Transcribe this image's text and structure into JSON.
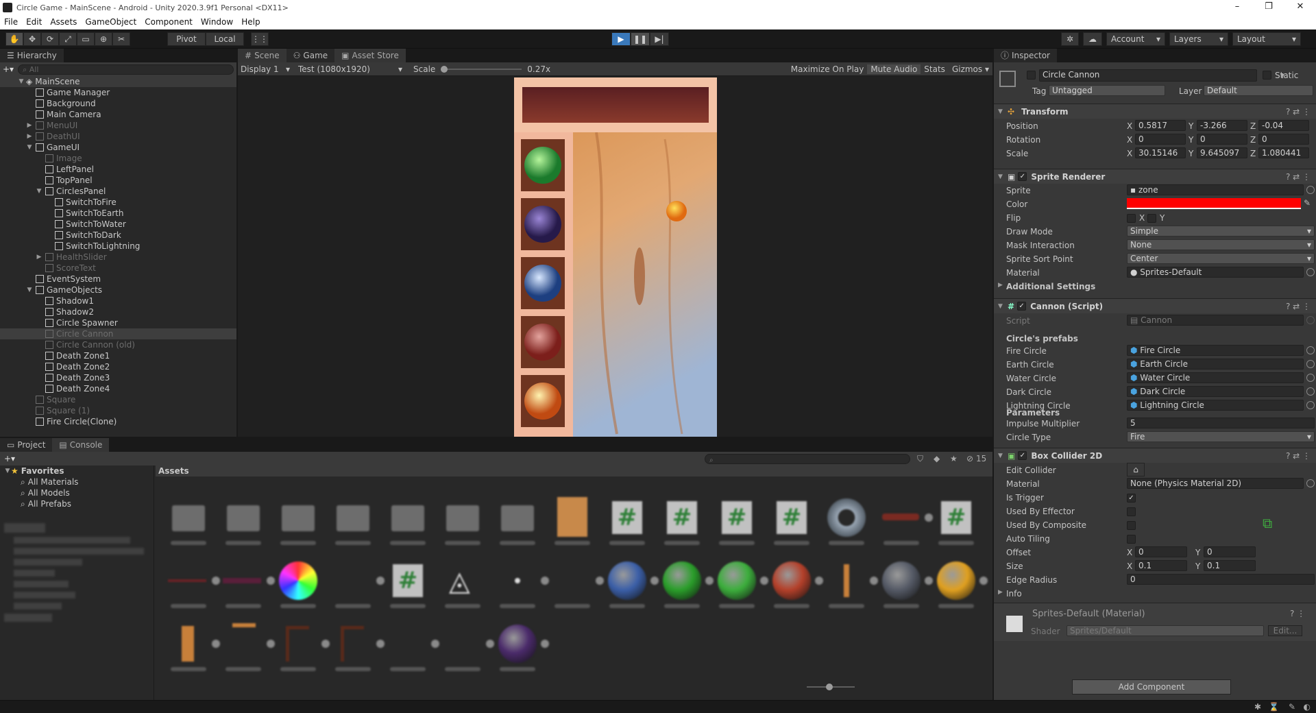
{
  "window": {
    "title": "Circle Game - MainScene - Android - Unity 2020.3.9f1 Personal <DX11>",
    "controls": [
      "–",
      "❐",
      "✕"
    ]
  },
  "menu": [
    "File",
    "Edit",
    "Assets",
    "GameObject",
    "Component",
    "Window",
    "Help"
  ],
  "toolbar": {
    "pivot": "Pivot",
    "local": "Local",
    "account": "Account",
    "layers": "Layers",
    "layout": "Layout"
  },
  "hierarchy": {
    "tab": "Hierarchy",
    "search_placeholder": "All",
    "scene": "MainScene",
    "items": [
      {
        "label": "Game Manager",
        "depth": 1,
        "dim": false,
        "fold": ""
      },
      {
        "label": "Background",
        "depth": 1,
        "dim": false,
        "fold": ""
      },
      {
        "label": "Main Camera",
        "depth": 1,
        "dim": false,
        "fold": ""
      },
      {
        "label": "MenuUI",
        "depth": 1,
        "dim": true,
        "fold": "▶"
      },
      {
        "label": "DeathUI",
        "depth": 1,
        "dim": true,
        "fold": "▶"
      },
      {
        "label": "GameUI",
        "depth": 1,
        "dim": false,
        "fold": "▼"
      },
      {
        "label": "Image",
        "depth": 2,
        "dim": true,
        "fold": ""
      },
      {
        "label": "LeftPanel",
        "depth": 2,
        "dim": false,
        "fold": ""
      },
      {
        "label": "TopPanel",
        "depth": 2,
        "dim": false,
        "fold": ""
      },
      {
        "label": "CirclesPanel",
        "depth": 2,
        "dim": false,
        "fold": "▼"
      },
      {
        "label": "SwitchToFire",
        "depth": 3,
        "dim": false,
        "fold": ""
      },
      {
        "label": "SwitchToEarth",
        "depth": 3,
        "dim": false,
        "fold": ""
      },
      {
        "label": "SwitchToWater",
        "depth": 3,
        "dim": false,
        "fold": ""
      },
      {
        "label": "SwitchToDark",
        "depth": 3,
        "dim": false,
        "fold": ""
      },
      {
        "label": "SwitchToLightning",
        "depth": 3,
        "dim": false,
        "fold": ""
      },
      {
        "label": "HealthSlider",
        "depth": 2,
        "dim": true,
        "fold": "▶"
      },
      {
        "label": "ScoreText",
        "depth": 2,
        "dim": true,
        "fold": ""
      },
      {
        "label": "EventSystem",
        "depth": 1,
        "dim": false,
        "fold": ""
      },
      {
        "label": "GameObjects",
        "depth": 1,
        "dim": false,
        "fold": "▼"
      },
      {
        "label": "Shadow1",
        "depth": 2,
        "dim": false,
        "fold": ""
      },
      {
        "label": "Shadow2",
        "depth": 2,
        "dim": false,
        "fold": ""
      },
      {
        "label": "Circle Spawner",
        "depth": 2,
        "dim": false,
        "fold": ""
      },
      {
        "label": "Circle Cannon",
        "depth": 2,
        "dim": true,
        "fold": "",
        "selected": true
      },
      {
        "label": "Circle Cannon (old)",
        "depth": 2,
        "dim": true,
        "fold": ""
      },
      {
        "label": "Death Zone1",
        "depth": 2,
        "dim": false,
        "fold": ""
      },
      {
        "label": "Death Zone2",
        "depth": 2,
        "dim": false,
        "fold": ""
      },
      {
        "label": "Death Zone3",
        "depth": 2,
        "dim": false,
        "fold": ""
      },
      {
        "label": "Death Zone4",
        "depth": 2,
        "dim": false,
        "fold": ""
      },
      {
        "label": "Square",
        "depth": 1,
        "dim": true,
        "fold": ""
      },
      {
        "label": "Square (1)",
        "depth": 1,
        "dim": true,
        "fold": ""
      },
      {
        "label": "Fire Circle(Clone)",
        "depth": 1,
        "dim": false,
        "fold": ""
      }
    ]
  },
  "gameview": {
    "tabs": [
      "Scene",
      "Game",
      "Asset Store"
    ],
    "display": "Display 1",
    "resolution": "Test (1080x1920)",
    "scale_label": "Scale",
    "scale_value": "0.27x",
    "maximize": "Maximize On Play",
    "mute": "Mute Audio",
    "stats": "Stats",
    "gizmos": "Gizmos"
  },
  "inspector": {
    "tab": "Inspector",
    "object_name": "Circle Cannon",
    "static_label": "Static",
    "tag_label": "Tag",
    "tag_value": "Untagged",
    "layer_label": "Layer",
    "layer_value": "Default",
    "transform": {
      "title": "Transform",
      "position_label": "Position",
      "position": [
        "0.5817",
        "-3.266",
        "-0.04"
      ],
      "rotation_label": "Rotation",
      "rotation": [
        "0",
        "0",
        "0"
      ],
      "scale_label": "Scale",
      "scale": [
        "30.15146",
        "9.645097",
        "1.080441"
      ]
    },
    "sprite_renderer": {
      "title": "Sprite Renderer",
      "sprite_label": "Sprite",
      "sprite": "zone",
      "color_label": "Color",
      "color": "#ff0000",
      "flip_label": "Flip",
      "flip_x": "X",
      "flip_y": "Y",
      "draw_mode_label": "Draw Mode",
      "draw_mode": "Simple",
      "mask_label": "Mask Interaction",
      "mask": "None",
      "sort_label": "Sprite Sort Point",
      "sort": "Center",
      "material_label": "Material",
      "material": "Sprites-Default",
      "additional": "Additional Settings"
    },
    "cannon": {
      "title": "Cannon (Script)",
      "script_label": "Script",
      "script": "Cannon",
      "prefabs_header": "Circle's prefabs",
      "prefabs": [
        {
          "label": "Fire Circle",
          "value": "Fire Circle"
        },
        {
          "label": "Earth Circle",
          "value": "Earth Circle"
        },
        {
          "label": "Water Circle",
          "value": "Water Circle"
        },
        {
          "label": "Dark Circle",
          "value": "Dark Circle"
        },
        {
          "label": "Lightning Circle",
          "value": "Lightning Circle"
        }
      ],
      "params_header": "Parameters",
      "impulse_label": "Impulse Multiplier",
      "impulse": "5",
      "circle_type_label": "Circle Type",
      "circle_type": "Fire"
    },
    "box_collider": {
      "title": "Box Collider 2D",
      "edit_label": "Edit Collider",
      "material_label": "Material",
      "material": "None (Physics Material 2D)",
      "trigger_label": "Is Trigger",
      "effector_label": "Used By Effector",
      "composite_label": "Used By Composite",
      "tiling_label": "Auto Tiling",
      "offset_label": "Offset",
      "offset": [
        "0",
        "0"
      ],
      "size_label": "Size",
      "size": [
        "0.1",
        "0.1"
      ],
      "edge_label": "Edge Radius",
      "edge": "0",
      "info_label": "Info"
    },
    "material_footer": {
      "title": "Sprites-Default (Material)",
      "shader_label": "Shader",
      "shader": "Sprites/Default",
      "edit": "Edit..."
    },
    "add_component": "Add Component"
  },
  "project": {
    "tabs": [
      "Project",
      "Console"
    ],
    "hidden_count": "15",
    "favorites": "Favorites",
    "favorite_items": [
      "All Materials",
      "All Models",
      "All Prefabs"
    ],
    "asset_header": "Assets"
  }
}
